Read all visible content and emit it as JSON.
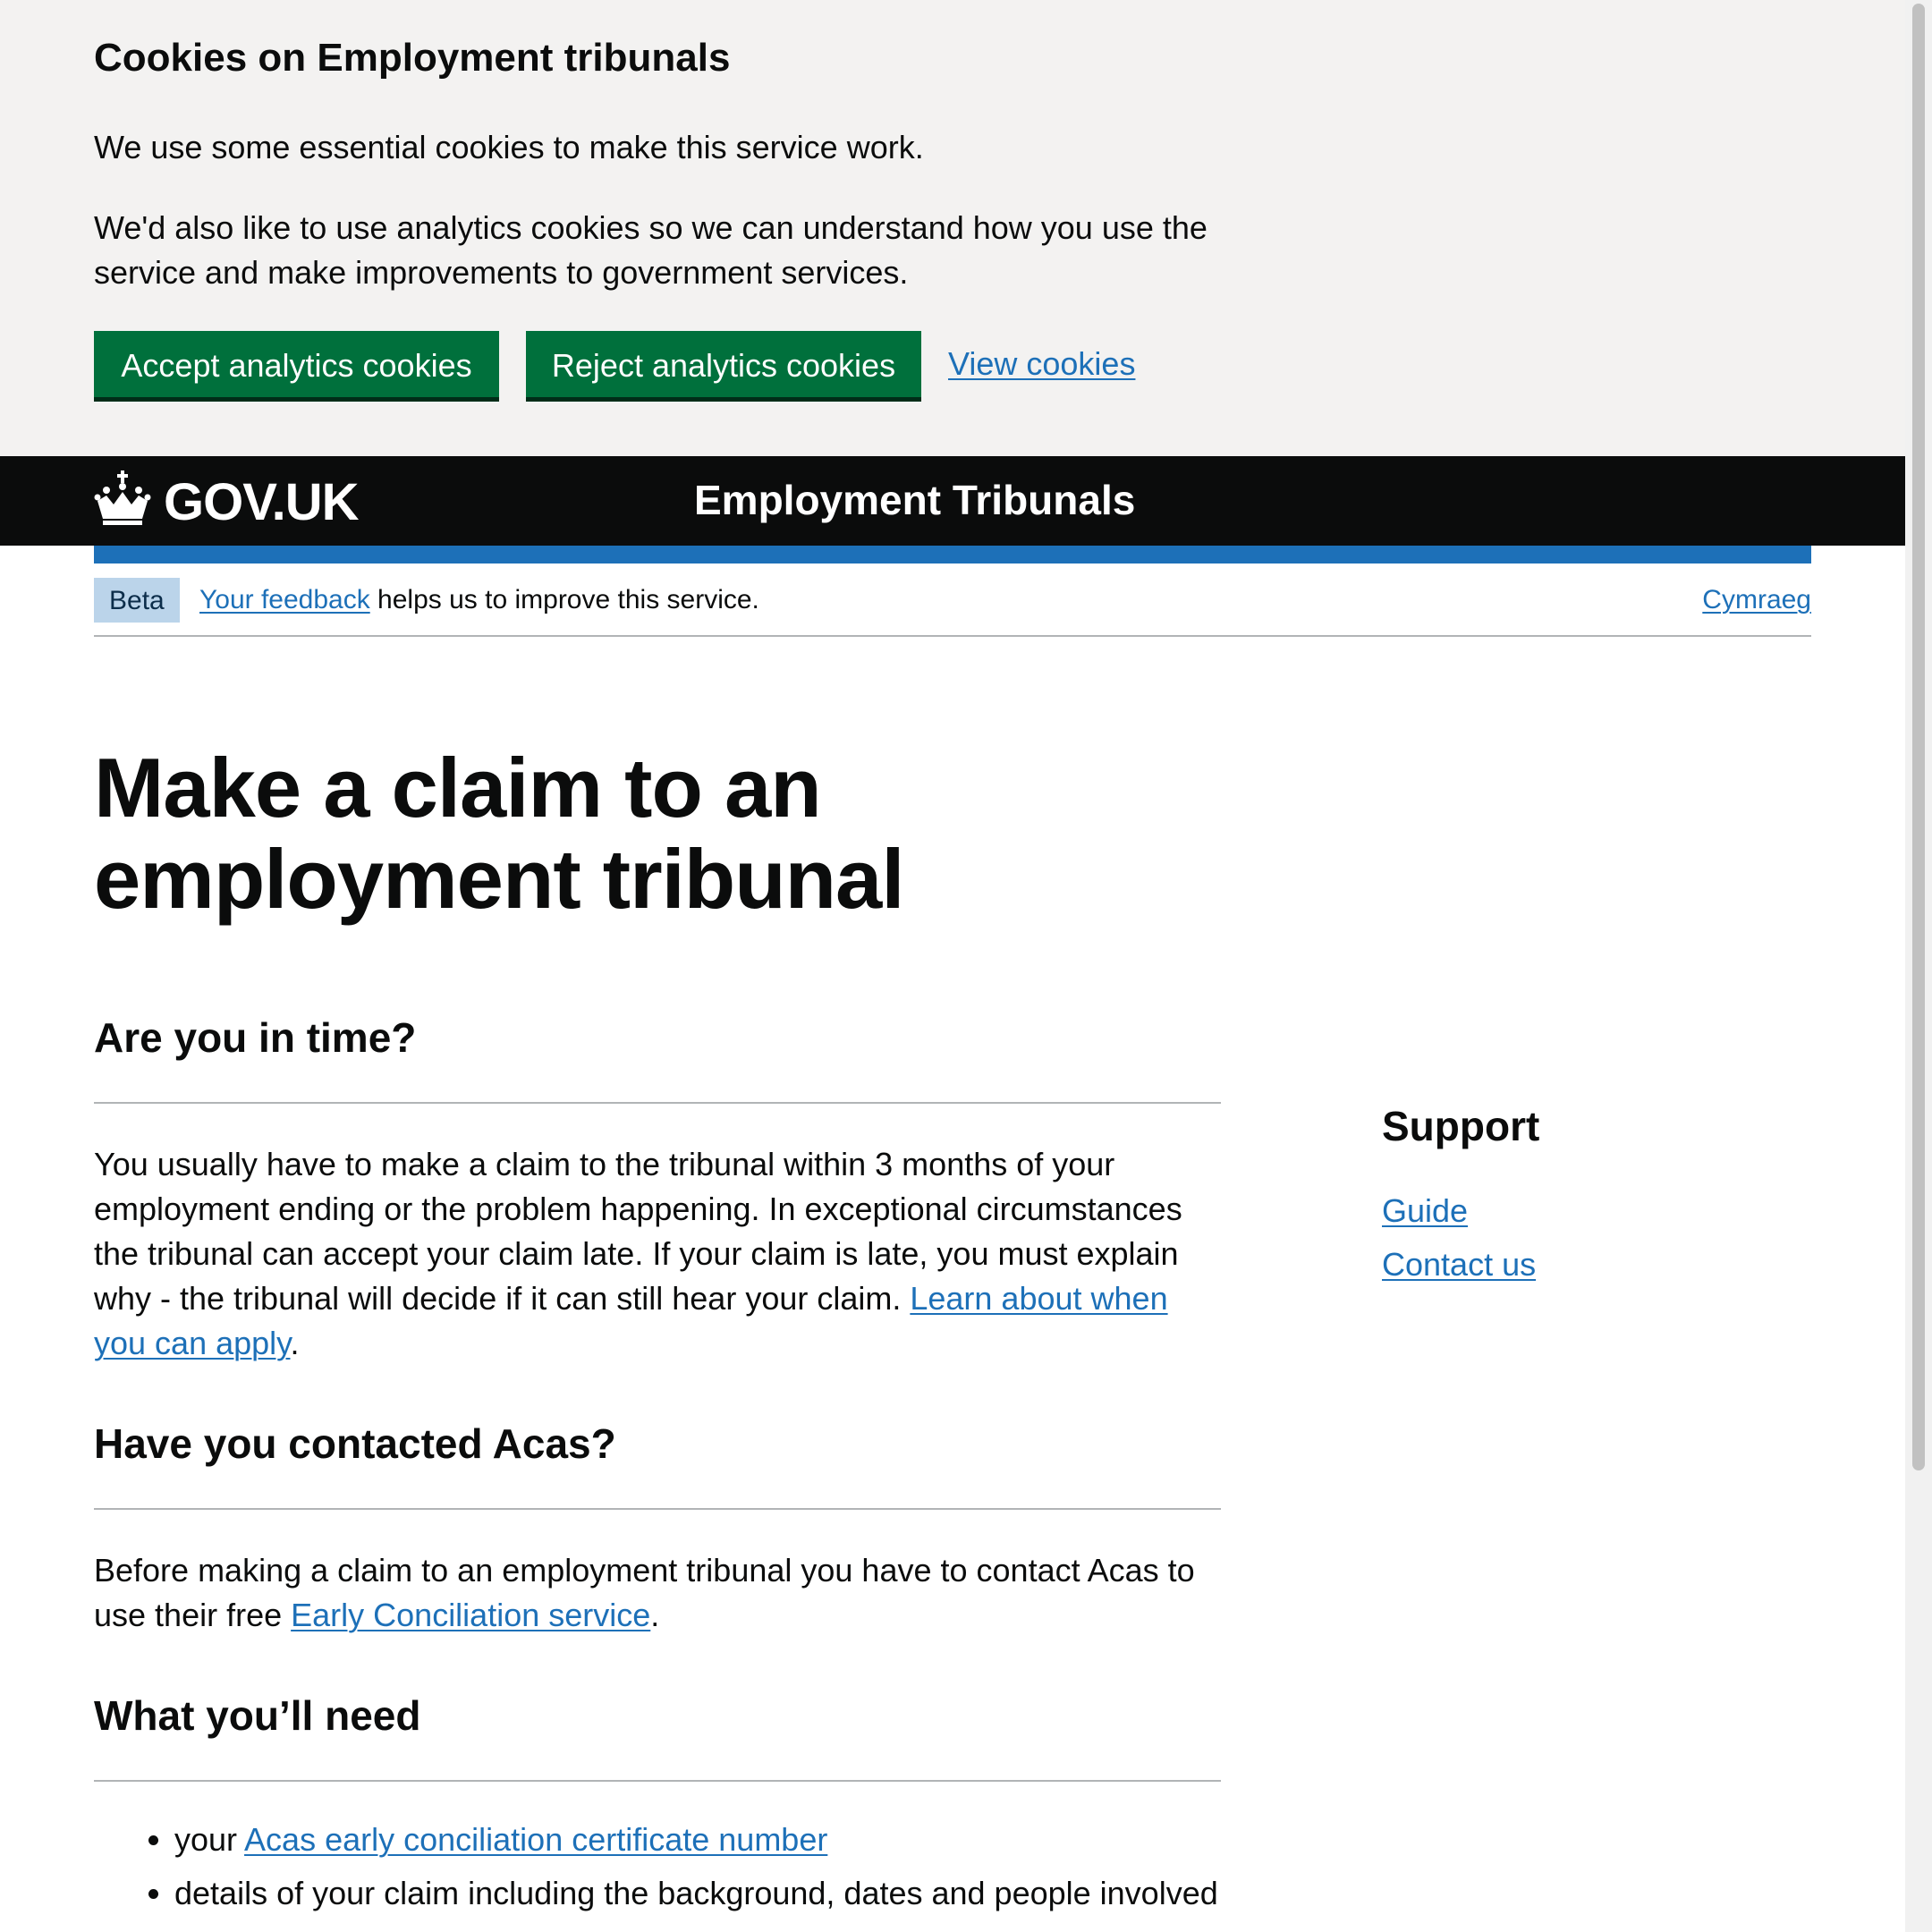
{
  "cookie_banner": {
    "title": "Cookies on Employment tribunals",
    "p1": "We use some essential cookies to make this service work.",
    "p2": "We'd also like to use analytics cookies so we can understand how you use the service and make improvements to government services.",
    "accept_label": "Accept analytics cookies",
    "reject_label": "Reject analytics cookies",
    "view_label": "View cookies"
  },
  "header": {
    "logo_text": "GOV.UK",
    "service_name": "Employment Tribunals"
  },
  "phase_banner": {
    "tag": "Beta",
    "feedback_link": "Your feedback",
    "text": " helps us to improve this service.",
    "language_link": "Cymraeg"
  },
  "main": {
    "title": "Make a claim to an employment tribunal",
    "sections": [
      {
        "heading": "Are you in time?",
        "text": "You usually have to make a claim to the tribunal within 3 months of your employment ending or the problem happening. In exceptional circumstances the tribunal can accept your claim late. If your claim is late, you must explain why - the tribunal will decide if it can still hear your claim. ",
        "link": "Learn about when you can apply",
        "after": "."
      },
      {
        "heading": "Have you contacted Acas?",
        "text": "Before making a claim to an employment tribunal you have to contact Acas to use their free ",
        "link": "Early Conciliation service",
        "after": "."
      },
      {
        "heading": "What you’ll need",
        "items": [
          {
            "prefix": "your ",
            "link": "Acas early conciliation certificate number"
          },
          {
            "text": "details of your claim including the background, dates and people involved"
          }
        ]
      }
    ]
  },
  "sidebar": {
    "title": "Support",
    "links": [
      "Guide",
      "Contact us"
    ]
  },
  "colors": {
    "button_green": "#00703c",
    "link_blue": "#1d70b8",
    "header_black": "#0b0c0c",
    "banner_grey": "#f3f2f1",
    "beta_tag_bg": "#bbd4ea"
  },
  "icons": {
    "logo": "crown-icon"
  }
}
